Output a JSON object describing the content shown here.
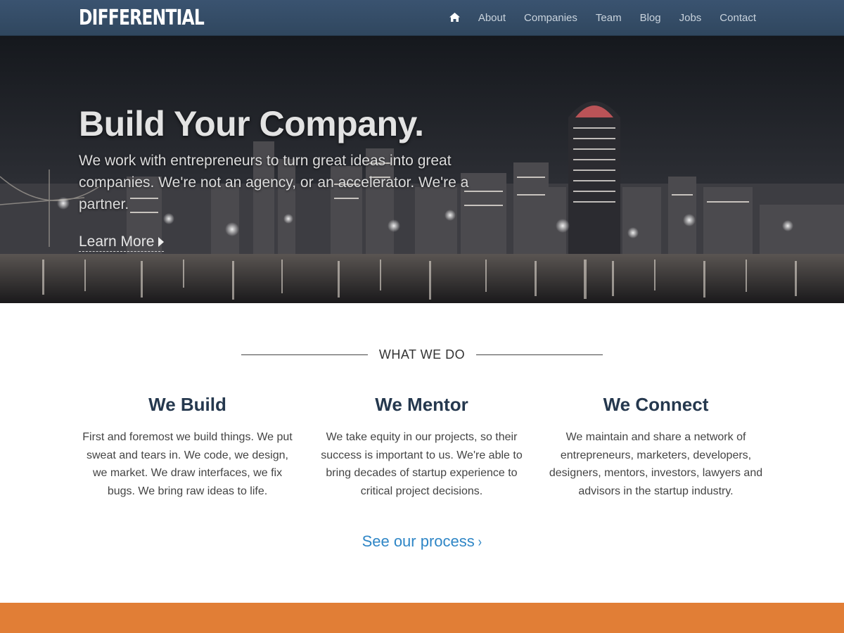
{
  "brand": {
    "logo": "DIFFERENTIAL"
  },
  "nav": {
    "home_icon": "home-icon",
    "items": [
      "About",
      "Companies",
      "Team",
      "Blog",
      "Jobs",
      "Contact"
    ]
  },
  "hero": {
    "title": "Build Your Company.",
    "text": "We work with entrepreneurs to turn great ideas into great companies. We're not an agency, or an accelerator. We're a partner.",
    "link": "Learn More"
  },
  "what_we_do": {
    "heading": "WHAT WE DO",
    "columns": [
      {
        "title": "We Build",
        "text": "First and foremost we build things. We put sweat and tears in. We code, we design, we market. We draw interfaces, we fix bugs. We bring raw ideas to life."
      },
      {
        "title": "We Mentor",
        "text": "We take equity in our projects, so their success is important to us. We're able to bring decades of startup experience to critical project decisions."
      },
      {
        "title": "We Connect",
        "text": "We maintain and share a network of entrepreneurs, marketers, developers, designers, mentors, investors, lawyers and advisors in the startup industry."
      }
    ],
    "process_link": "See our process",
    "process_chevron": "›"
  },
  "colors": {
    "nav_bg": "#34495e",
    "heading": "#25384e",
    "link": "#2f86c6",
    "accent_band": "#e17e36"
  }
}
